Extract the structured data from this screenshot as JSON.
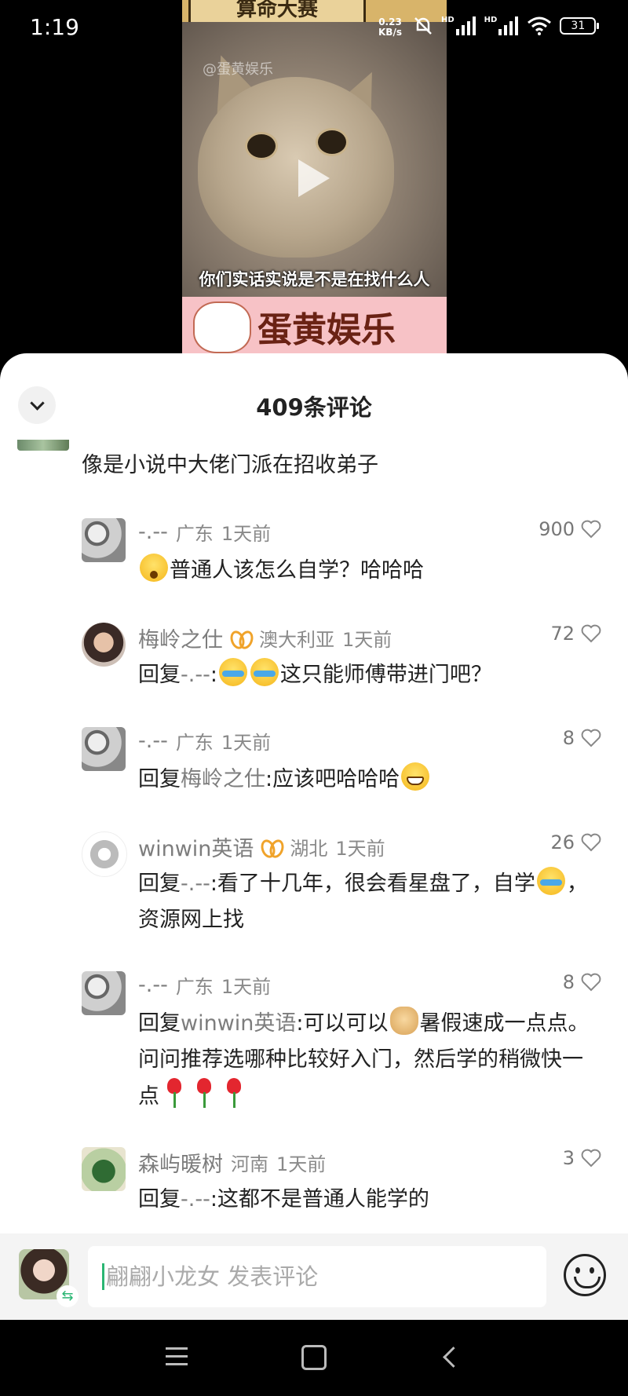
{
  "status_bar": {
    "time": "1:19",
    "net_speed_value": "0.23",
    "net_speed_unit": "KB/s",
    "hd1": "HD",
    "hd2": "HD",
    "battery": "31"
  },
  "video": {
    "banner_text": "算命大赛",
    "watermark": "@蛋黄娱乐",
    "subtitle": "你们实话实说是不是在找什么人",
    "footer_text": "蛋黄娱乐"
  },
  "sheet": {
    "title": "409条评论"
  },
  "parent_comment": {
    "text": "像是小说中大佬门派在招收弟子"
  },
  "replies": [
    {
      "username": "-.--",
      "location": "广东",
      "time": "1天前",
      "likes": "900",
      "segments": [
        {
          "emoji": "shock"
        },
        {
          "text": "普通人该怎么自学？哈哈哈"
        }
      ]
    },
    {
      "username": "梅岭之仕",
      "badge": true,
      "location": "澳大利亚",
      "time": "1天前",
      "likes": "72",
      "segments": [
        {
          "text": "回复"
        },
        {
          "mention": "-.--"
        },
        {
          "text": ":"
        },
        {
          "emoji": "cry"
        },
        {
          "emoji": "cry"
        },
        {
          "text": "这只能师傅带进门吧？"
        }
      ]
    },
    {
      "username": "-.--",
      "location": "广东",
      "time": "1天前",
      "likes": "8",
      "segments": [
        {
          "text": "回复"
        },
        {
          "mention": "梅岭之仕"
        },
        {
          "text": ":应该吧哈哈哈"
        },
        {
          "emoji": "grin"
        }
      ]
    },
    {
      "username": "winwin英语",
      "badge": true,
      "location": "湖北",
      "time": "1天前",
      "likes": "26",
      "segments": [
        {
          "text": "回复"
        },
        {
          "mention": "-.--"
        },
        {
          "text": ":看了十几年，很会看星盘了，自学"
        },
        {
          "emoji": "cry"
        },
        {
          "text": "，资源网上找"
        }
      ]
    },
    {
      "username": "-.--",
      "location": "广东",
      "time": "1天前",
      "likes": "8",
      "segments": [
        {
          "text": "回复"
        },
        {
          "mention": "winwin英语"
        },
        {
          "text": ":可以可以"
        },
        {
          "emoji": "doge"
        },
        {
          "text": "暑假速成一点点。问问推荐选哪种比较好入门，然后学的稍微快一点"
        },
        {
          "rose": true
        },
        {
          "rose": true
        },
        {
          "rose": true
        }
      ]
    },
    {
      "username": "森屿暖树",
      "location": "河南",
      "time": "1天前",
      "likes": "3",
      "segments": [
        {
          "text": "回复"
        },
        {
          "mention": "-.--"
        },
        {
          "text": ":这都不是普通人能学的"
        }
      ]
    }
  ],
  "input_bar": {
    "placeholder": "翩翩小龙女 发表评论"
  },
  "colors": {
    "accent_green": "#2bb673",
    "badge_orange": "#f0a32a",
    "sheet_bg": "#ffffff"
  }
}
